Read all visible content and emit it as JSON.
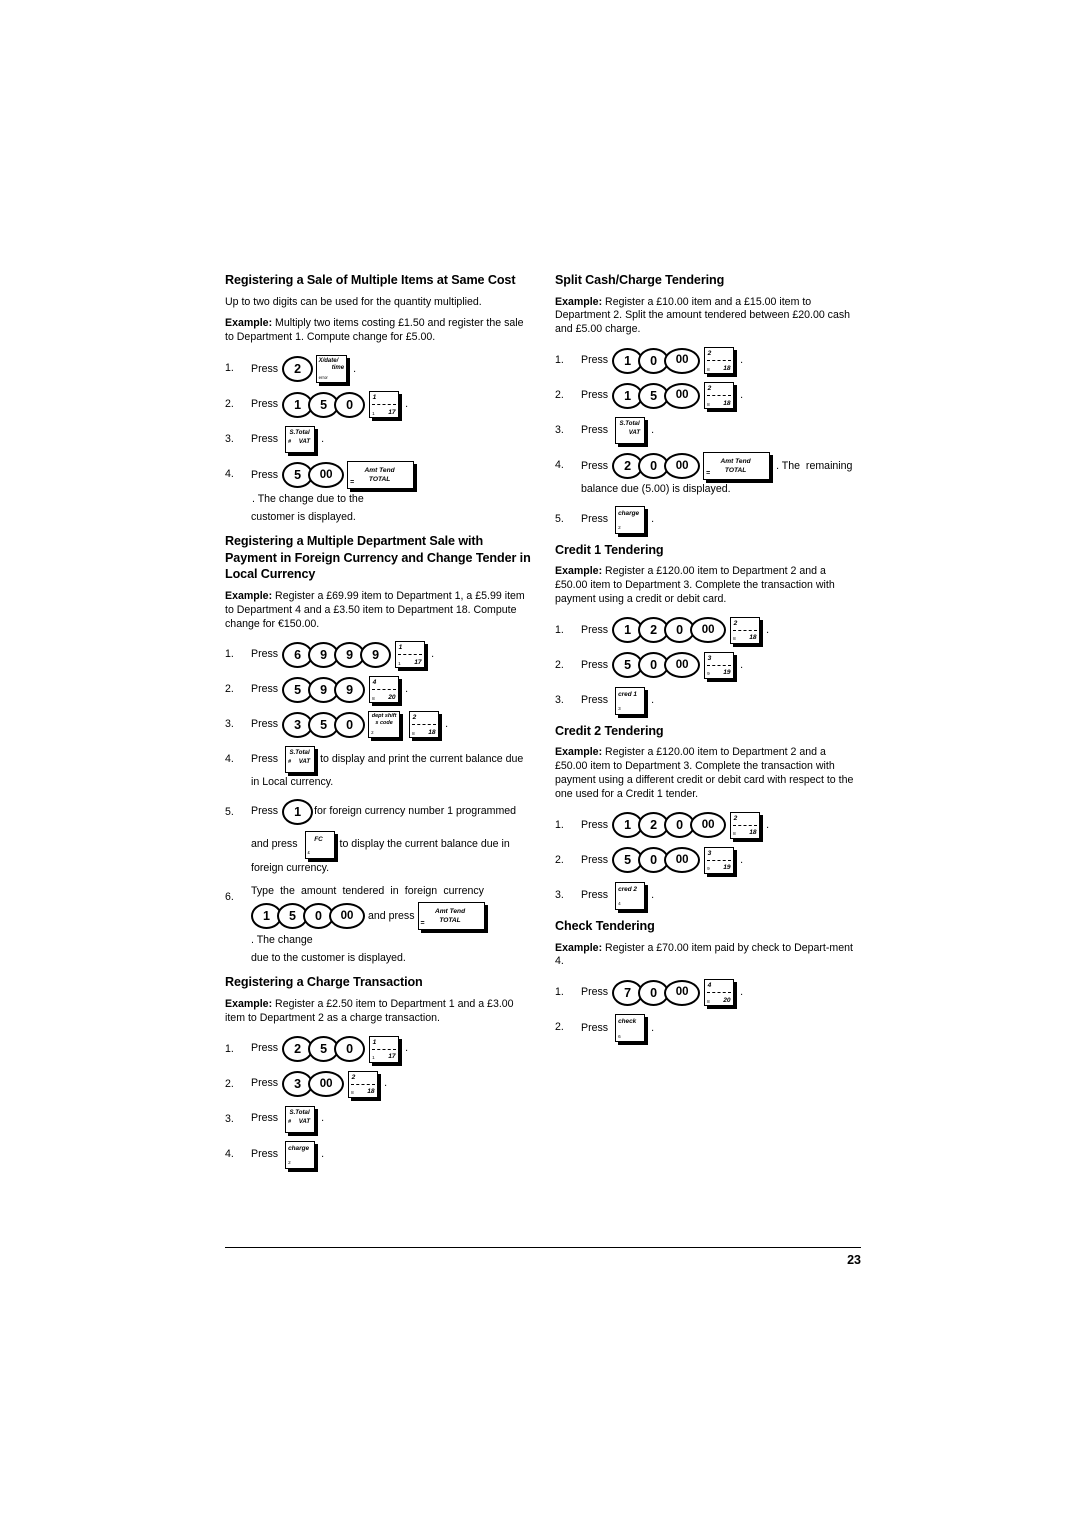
{
  "page": {
    "number": "23"
  },
  "left_column": {
    "section1": {
      "heading": "Registering a Sale of Multiple Items at Same Cost",
      "intro": "Up to two digits can be used for the quantity multiplied.",
      "example_label": "Example:",
      "example_text": " Multiply two items costing £1.50 and register the sale to Department 1. Compute change for £5.00.",
      "steps": [
        {
          "num": "1.",
          "press": "Press",
          "keys": "2 , X/date/time",
          "tail": "."
        },
        {
          "num": "2.",
          "press": "Press",
          "keys": "1 5 0 , dept 1",
          "tail": "."
        },
        {
          "num": "3.",
          "press": "Press",
          "keys": "S.Total/VAT",
          "tail": "."
        },
        {
          "num": "4.",
          "press": "Press",
          "keys": "5 00 , Amt Tend TOTAL",
          "tail": ". The change due to the",
          "cont": "customer is displayed."
        }
      ]
    },
    "section2": {
      "heading": "Registering a Multiple Department Sale with Payment in Foreign Currency and Change Tender in Local Currency",
      "example_label": "Example:",
      "example_text": " Register a £69.99 item to Department 1, a £5.99 item to Department 4 and a £3.50 item to Department 18. Compute change for €150.00.",
      "steps": [
        {
          "num": "1.",
          "press": "Press",
          "tail": "."
        },
        {
          "num": "2.",
          "press": "Press",
          "tail": "."
        },
        {
          "num": "3.",
          "press": "Press",
          "tail": "."
        },
        {
          "num": "4.",
          "press": "Press",
          "tail": "to display and print the current balance due",
          "cont": "in Local currency."
        },
        {
          "num": "5.",
          "press": "Press",
          "mid": "for foreign currency number 1 programmed",
          "cont1": "and press",
          "mid2": "to display the current balance due in",
          "cont2": "foreign currency."
        },
        {
          "num": "6.",
          "text": "Type the amount tendered in foreign currency",
          "mid": "and press",
          "tail": ". The change",
          "cont": "due to the customer is displayed."
        }
      ]
    },
    "section3": {
      "heading": "Registering a Charge Transaction",
      "example_label": "Example:",
      "example_text": " Register a £2.50 item to Department 1 and a £3.00 item to Department 2 as a charge transaction.",
      "steps": [
        {
          "num": "1.",
          "press": "Press",
          "tail": "."
        },
        {
          "num": "2.",
          "press": "Press",
          "tail": "."
        },
        {
          "num": "3.",
          "press": "Press",
          "tail": "."
        },
        {
          "num": "4.",
          "press": "Press",
          "tail": "."
        }
      ]
    }
  },
  "right_column": {
    "section1": {
      "heading": "Split Cash/Charge Tendering",
      "example_label": "Example:",
      "example_text": " Register a £10.00 item and a £15.00 item to Department 2. Split the amount tendered between £20.00 cash and £5.00 charge.",
      "steps": [
        {
          "num": "1.",
          "press": "Press",
          "tail": "."
        },
        {
          "num": "2.",
          "press": "Press",
          "tail": "."
        },
        {
          "num": "3.",
          "press": "Press",
          "tail": "."
        },
        {
          "num": "4.",
          "press": "Press",
          "tail": ". The  remaining",
          "cont": "balance due (5.00) is displayed."
        },
        {
          "num": "5.",
          "press": "Press",
          "tail": "."
        }
      ]
    },
    "section2": {
      "heading": "Credit 1 Tendering",
      "example_label": "Example:",
      "example_text": " Register a £120.00 item to Department 2 and a £50.00 item to Department 3. Complete the transaction with payment using a credit or debit card.",
      "steps": [
        {
          "num": "1.",
          "press": "Press",
          "tail": "."
        },
        {
          "num": "2.",
          "press": "Press",
          "tail": "."
        },
        {
          "num": "3.",
          "press": "Press",
          "tail": "."
        }
      ]
    },
    "section3": {
      "heading": "Credit 2 Tendering",
      "example_label": "Example:",
      "example_text": " Register a £120.00 item to Department 2 and a £50.00 item to Department 3. Complete the transaction with payment using a different credit or debit card with respect to the one used for a Credit 1 tender.",
      "steps": [
        {
          "num": "1.",
          "press": "Press",
          "tail": "."
        },
        {
          "num": "2.",
          "press": "Press",
          "tail": "."
        },
        {
          "num": "3.",
          "press": "Press",
          "tail": "."
        }
      ]
    },
    "section4": {
      "heading": "Check Tendering",
      "example_label": "Example:",
      "example_text": " Register a £70.00 item paid by check to Depart-ment 4.",
      "steps": [
        {
          "num": "1.",
          "press": "Press",
          "tail": "."
        },
        {
          "num": "2.",
          "press": "Press",
          "tail": "."
        }
      ]
    }
  },
  "keys": {
    "digit_2": "2",
    "digit_1": "1",
    "digit_5": "5",
    "digit_0": "0",
    "digit_3": "3",
    "digit_6": "6",
    "digit_9": "9",
    "digit_7": "7",
    "digit_00": "00",
    "xdate": {
      "line1": "X/date/",
      "line2": "time",
      "corner": "error"
    },
    "stotal": {
      "line1": "S.Total",
      "line2": "VAT",
      "corner": "#"
    },
    "total": {
      "line1": "Amt Tend",
      "line2": "TOTAL",
      "corner": "="
    },
    "deptshift": {
      "line1": "dept shift",
      "line2": "s code",
      "corner": "2"
    },
    "fc": {
      "label": "FC",
      "corner": "£"
    },
    "charge": {
      "label": "charge",
      "corner": "2"
    },
    "cred1": {
      "label": "cred 1",
      "corner": "3"
    },
    "cred2": {
      "label": "cred 2",
      "corner": "4"
    },
    "check": {
      "label": "check",
      "corner": "6"
    },
    "dept1": {
      "num": "1",
      "sub": "1",
      "high": "17"
    },
    "dept2": {
      "num": "2",
      "sub": "8",
      "high": "18"
    },
    "dept3": {
      "num": "3",
      "sub": "9",
      "high": "19"
    },
    "dept4": {
      "num": "4",
      "sub": "8",
      "high": "20"
    }
  }
}
